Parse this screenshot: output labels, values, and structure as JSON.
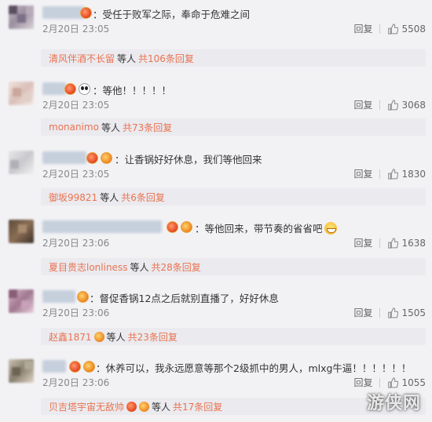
{
  "comments": [
    {
      "text": "：受任于败军之际，奉命于危难之间",
      "time": "2月20日 23:05",
      "reply_label": "回复",
      "likes": "5508",
      "reply_summary": {
        "name": "清风伴酒不长留",
        "suffix": "等人",
        "count": "共106条回复"
      }
    },
    {
      "text": "：等他！！！！！",
      "time": "2月20日 23:05",
      "reply_label": "回复",
      "likes": "3068",
      "reply_summary": {
        "name": "monanimo",
        "suffix": "等人",
        "count": "共73条回复"
      }
    },
    {
      "text": "：让香锅好好休息，我们等他回来",
      "time": "2月20日 23:05",
      "reply_label": "回复",
      "likes": "1830",
      "reply_summary": {
        "name": "御坂99821",
        "suffix": "等人",
        "count": "共6条回复"
      }
    },
    {
      "text": "：等他回来，带节奏的省省吧",
      "time": "2月20日 23:06",
      "reply_label": "回复",
      "likes": "1638",
      "reply_summary": {
        "name": "夏目贵志lonliness",
        "suffix": "等人",
        "count": "共28条回复"
      }
    },
    {
      "text": "：督促香锅12点之后就别直播了，好好休息",
      "time": "2月20日 23:06",
      "reply_label": "回复",
      "likes": "1505",
      "reply_summary": {
        "name": "赵鑫1871",
        "suffix": "等人",
        "count": "共23条回复"
      }
    },
    {
      "text": "：休养可以，我永远愿意等那个2级抓中的男人，mlxg牛逼！！！！！！",
      "time": "2月20日 23:06",
      "reply_label": "回复",
      "likes": "1055",
      "reply_summary": {
        "name": "贝吉塔宇宙无敌帅",
        "suffix": "等人",
        "count": "共17条回复"
      }
    }
  ],
  "watermark": "游侠网",
  "colors": {
    "background": "#f2f2f5",
    "link": "#eb7350",
    "time": "#888888"
  }
}
